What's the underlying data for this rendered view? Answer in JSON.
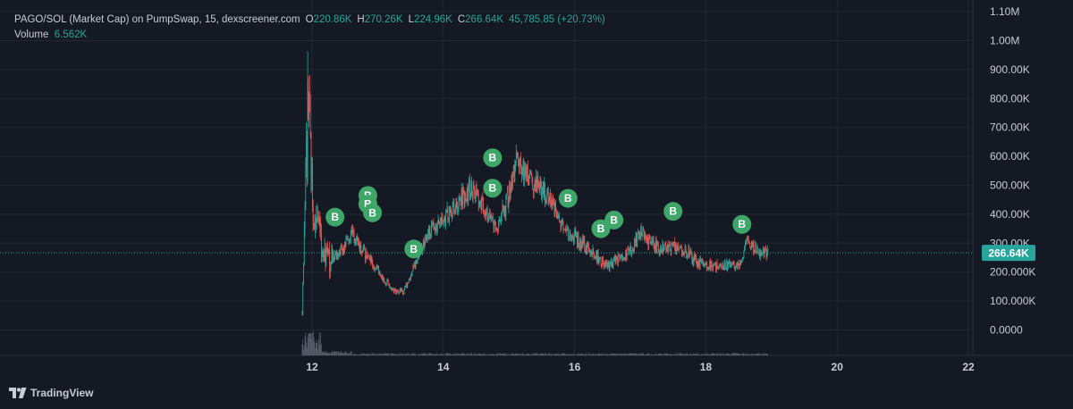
{
  "legend": {
    "symbol": "PAGO/SOL (Market Cap) on PumpSwap, 15, dexscreener.com",
    "open_label": "O",
    "open_value": "220.86K",
    "high_label": "H",
    "high_value": "270.26K",
    "low_label": "L",
    "low_value": "224.96K",
    "close_label": "C",
    "close_value": "266.64K",
    "change_value": "45,785.85 (+20.73%)",
    "volume_label": "Volume",
    "volume_value": "6.562K"
  },
  "brand": {
    "name": "TradingView"
  },
  "colors": {
    "background": "#151924",
    "grid": "#232734",
    "up": "#26a69a",
    "down": "#ef5350",
    "marker": "#3fa66a",
    "volume": "#6d7480",
    "price_tag": "#26a69a",
    "axis_text": "#c8ccd6"
  },
  "chart_data": {
    "type": "candlestick",
    "y_axis": {
      "min": 0,
      "max": 1100000,
      "ticks": [
        {
          "value": 0,
          "label": "0.0000"
        },
        {
          "value": 100000,
          "label": "100.000K"
        },
        {
          "value": 200000,
          "label": "200.000K"
        },
        {
          "value": 300000,
          "label": "300.00K"
        },
        {
          "value": 400000,
          "label": "400.00K"
        },
        {
          "value": 500000,
          "label": "500.00K"
        },
        {
          "value": 600000,
          "label": "600.00K"
        },
        {
          "value": 700000,
          "label": "700.00K"
        },
        {
          "value": 800000,
          "label": "800.00K"
        },
        {
          "value": 900000,
          "label": "900.00K"
        },
        {
          "value": 1000000,
          "label": "1.00M"
        },
        {
          "value": 1100000,
          "label": "1.10M"
        }
      ]
    },
    "x_axis": {
      "ticks": [
        {
          "value": 12,
          "label": "12"
        },
        {
          "value": 14,
          "label": "14"
        },
        {
          "value": 16,
          "label": "16"
        },
        {
          "value": 18,
          "label": "18"
        },
        {
          "value": 20,
          "label": "20"
        },
        {
          "value": 22,
          "label": "22"
        }
      ]
    },
    "current_price": {
      "value": 266640,
      "label": "266.64K"
    },
    "series": [
      {
        "x": 11.85,
        "y": 60000
      },
      {
        "x": 11.95,
        "y": 880000
      },
      {
        "x": 12.0,
        "y": 450000
      },
      {
        "x": 12.1,
        "y": 330000
      },
      {
        "x": 12.25,
        "y": 240000
      },
      {
        "x": 12.45,
        "y": 270000
      },
      {
        "x": 12.6,
        "y": 340000
      },
      {
        "x": 12.8,
        "y": 260000
      },
      {
        "x": 13.0,
        "y": 210000
      },
      {
        "x": 13.2,
        "y": 140000
      },
      {
        "x": 13.4,
        "y": 130000
      },
      {
        "x": 13.6,
        "y": 250000
      },
      {
        "x": 13.8,
        "y": 340000
      },
      {
        "x": 14.0,
        "y": 380000
      },
      {
        "x": 14.2,
        "y": 430000
      },
      {
        "x": 14.4,
        "y": 490000
      },
      {
        "x": 14.6,
        "y": 440000
      },
      {
        "x": 14.8,
        "y": 340000
      },
      {
        "x": 15.0,
        "y": 460000
      },
      {
        "x": 15.1,
        "y": 580000
      },
      {
        "x": 15.35,
        "y": 520000
      },
      {
        "x": 15.6,
        "y": 470000
      },
      {
        "x": 15.8,
        "y": 360000
      },
      {
        "x": 16.0,
        "y": 320000
      },
      {
        "x": 16.3,
        "y": 260000
      },
      {
        "x": 16.5,
        "y": 220000
      },
      {
        "x": 16.8,
        "y": 260000
      },
      {
        "x": 17.0,
        "y": 330000
      },
      {
        "x": 17.3,
        "y": 280000
      },
      {
        "x": 17.6,
        "y": 290000
      },
      {
        "x": 17.9,
        "y": 230000
      },
      {
        "x": 18.2,
        "y": 220000
      },
      {
        "x": 18.5,
        "y": 230000
      },
      {
        "x": 18.65,
        "y": 310000
      },
      {
        "x": 18.8,
        "y": 260000
      },
      {
        "x": 18.95,
        "y": 266640
      }
    ],
    "markers": [
      {
        "x": 12.35,
        "label": "B",
        "y": 390000
      },
      {
        "x": 12.85,
        "label": "B",
        "y": 465000
      },
      {
        "x": 12.85,
        "label": "B",
        "y": 435000
      },
      {
        "x": 12.92,
        "label": "B",
        "y": 405000
      },
      {
        "x": 13.55,
        "label": "B",
        "y": 280000
      },
      {
        "x": 14.75,
        "label": "B",
        "y": 595000
      },
      {
        "x": 14.75,
        "label": "B",
        "y": 490000
      },
      {
        "x": 15.9,
        "label": "B",
        "y": 455000
      },
      {
        "x": 16.4,
        "label": "B",
        "y": 350000
      },
      {
        "x": 16.6,
        "label": "B",
        "y": 380000
      },
      {
        "x": 17.5,
        "label": "B",
        "y": 410000
      },
      {
        "x": 18.55,
        "label": "B",
        "y": 365000
      }
    ]
  }
}
